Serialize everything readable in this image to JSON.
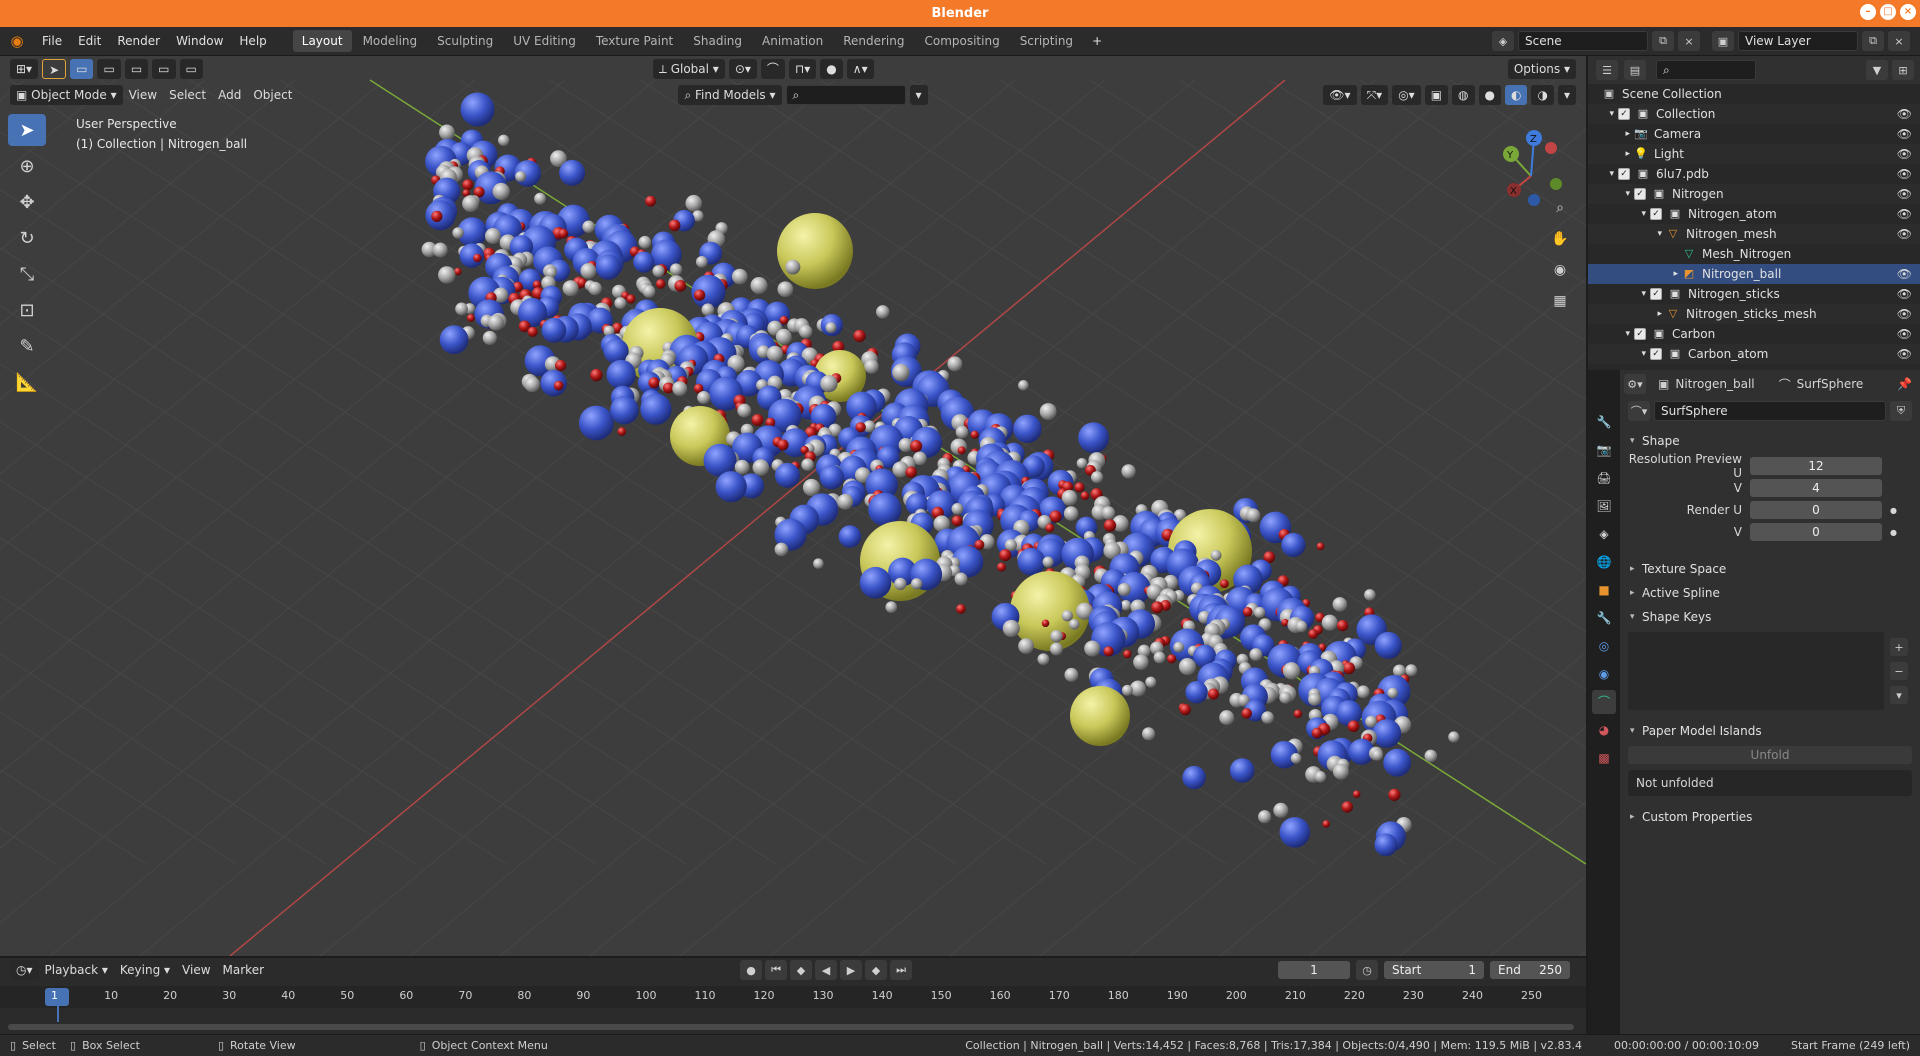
{
  "window": {
    "title": "Blender"
  },
  "menu": [
    "File",
    "Edit",
    "Render",
    "Window",
    "Help"
  ],
  "workspaces": [
    "Layout",
    "Modeling",
    "Sculpting",
    "UV Editing",
    "Texture Paint",
    "Shading",
    "Animation",
    "Rendering",
    "Compositing",
    "Scripting"
  ],
  "scene": {
    "name": "Scene",
    "view_layer": "View Layer"
  },
  "viewport": {
    "transform_orientation": "Global",
    "options_label": "Options",
    "mode": "Object Mode",
    "menus": [
      "View",
      "Select",
      "Add",
      "Object"
    ],
    "find_models": "Find Models",
    "info_line1": "User Perspective",
    "info_line2": "(1) Collection | Nitrogen_ball"
  },
  "outliner": {
    "rows": [
      {
        "label": "Scene Collection",
        "indent": 0,
        "icon": "scene-collection-icon",
        "chk": false,
        "eye": false
      },
      {
        "label": "Collection",
        "indent": 1,
        "icon": "collection-icon",
        "chk": true,
        "eye": true,
        "exp": "▾"
      },
      {
        "label": "Camera",
        "indent": 2,
        "icon": "camera-icon",
        "chk": false,
        "eye": true,
        "exp": "▸"
      },
      {
        "label": "Light",
        "indent": 2,
        "icon": "light-icon",
        "chk": false,
        "eye": true,
        "exp": "▸"
      },
      {
        "label": "6lu7.pdb",
        "indent": 1,
        "icon": "collection-icon",
        "chk": true,
        "eye": true,
        "exp": "▾"
      },
      {
        "label": "Nitrogen",
        "indent": 2,
        "icon": "collection-icon",
        "chk": true,
        "eye": true,
        "exp": "▾"
      },
      {
        "label": "Nitrogen_atom",
        "indent": 3,
        "icon": "collection-icon",
        "chk": true,
        "eye": true,
        "exp": "▾"
      },
      {
        "label": "Nitrogen_mesh",
        "indent": 4,
        "icon": "mesh-object-icon",
        "chk": false,
        "eye": true,
        "exp": "▾"
      },
      {
        "label": "Mesh_Nitrogen",
        "indent": 5,
        "icon": "mesh-data-icon",
        "chk": false,
        "eye": false
      },
      {
        "label": "Nitrogen_ball",
        "indent": 5,
        "icon": "surface-object-icon",
        "chk": false,
        "eye": true,
        "sel": true,
        "exp": "▸"
      },
      {
        "label": "Nitrogen_sticks",
        "indent": 3,
        "icon": "collection-icon",
        "chk": true,
        "eye": true,
        "exp": "▾"
      },
      {
        "label": "Nitrogen_sticks_mesh",
        "indent": 4,
        "icon": "mesh-object-icon",
        "chk": false,
        "eye": true,
        "exp": "▸"
      },
      {
        "label": "Carbon",
        "indent": 2,
        "icon": "collection-icon",
        "chk": true,
        "eye": true,
        "exp": "▾"
      },
      {
        "label": "Carbon_atom",
        "indent": 3,
        "icon": "collection-icon",
        "chk": true,
        "eye": true,
        "exp": "▾"
      }
    ]
  },
  "properties": {
    "object_name": "Nitrogen_ball",
    "data_name": "SurfSphere",
    "datablock": "SurfSphere",
    "shape_panel": "Shape",
    "res_preview_u_label": "Resolution Preview U",
    "res_preview_u": "12",
    "res_preview_v_label": "V",
    "res_preview_v": "4",
    "render_u_label": "Render U",
    "render_u": "0",
    "render_v_label": "V",
    "render_v": "0",
    "texture_space": "Texture Space",
    "active_spline": "Active Spline",
    "shape_keys": "Shape Keys",
    "paper_model": "Paper Model Islands",
    "unfold": "Unfold",
    "not_unfolded": "Not unfolded",
    "custom_props": "Custom Properties"
  },
  "timeline": {
    "menus": [
      "Playback",
      "Keying",
      "View",
      "Marker"
    ],
    "current_frame": "1",
    "start_label": "Start",
    "start": "1",
    "end_label": "End",
    "end": "250",
    "ticks": [
      "1",
      "10",
      "20",
      "30",
      "40",
      "50",
      "60",
      "70",
      "80",
      "90",
      "100",
      "110",
      "120",
      "130",
      "140",
      "150",
      "160",
      "170",
      "180",
      "190",
      "200",
      "210",
      "220",
      "230",
      "240",
      "250"
    ]
  },
  "status": {
    "select": "Select",
    "box_select": "Box Select",
    "rotate_view": "Rotate View",
    "context_menu": "Object Context Menu",
    "stats": "Collection | Nitrogen_ball | Verts:14,452 | Faces:8,768 | Tris:17,384 | Objects:0/4,490 | Mem: 119.5 MiB | v2.83.4",
    "time": "00:00:00:00 / 00:00:10:09",
    "start_frame": "Start Frame (249 left)"
  },
  "colors": {
    "accent": "#4772b3",
    "titlebar": "#f47a2a",
    "nitrogen": "#3b55c9",
    "carbon": "#a8a8a8",
    "oxygen": "#b01818",
    "sulfur": "#c9c85a"
  }
}
